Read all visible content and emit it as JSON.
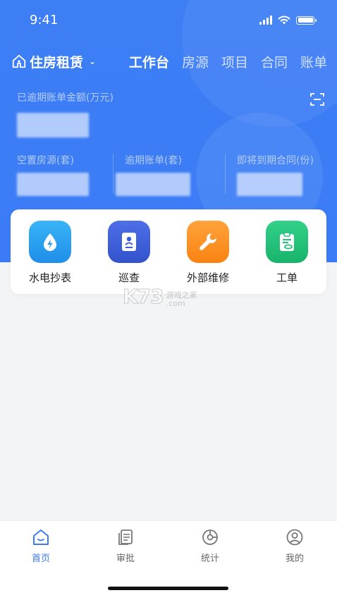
{
  "status_bar": {
    "time": "9:41"
  },
  "header": {
    "org_name": "住房租赁",
    "tabs": [
      {
        "label": "工作台",
        "active": true
      },
      {
        "label": "房源",
        "active": false
      },
      {
        "label": "项目",
        "active": false
      },
      {
        "label": "合同",
        "active": false
      },
      {
        "label": "账单",
        "active": false
      }
    ],
    "overdue_amount_label": "已逾期账单金额(万元)",
    "stats": [
      {
        "label": "空置房源(套)"
      },
      {
        "label": "逾期账单(套)"
      },
      {
        "label": "即将到期合同(份)"
      }
    ]
  },
  "quick_actions": [
    {
      "label": "水电抄表",
      "icon": "water-drop-bolt-icon",
      "color": "#2a9bf0"
    },
    {
      "label": "巡查",
      "icon": "inspection-badge-icon",
      "color": "#3b5bd8"
    },
    {
      "label": "外部维修",
      "icon": "wrench-icon",
      "color": "#fb8d1f"
    },
    {
      "label": "工单",
      "icon": "clipboard-icon",
      "color": "#23c27a"
    }
  ],
  "watermark": {
    "logo": "K73",
    "line1": "游戏之家",
    "line2": ".com"
  },
  "bottom_nav": [
    {
      "label": "首页",
      "icon": "home-icon",
      "active": true
    },
    {
      "label": "审批",
      "icon": "document-icon",
      "active": false
    },
    {
      "label": "统计",
      "icon": "chart-icon",
      "active": false
    },
    {
      "label": "我的",
      "icon": "user-icon",
      "active": false
    }
  ],
  "colors": {
    "brand": "#3b7cf6",
    "page_bg": "#f3f4f6"
  }
}
